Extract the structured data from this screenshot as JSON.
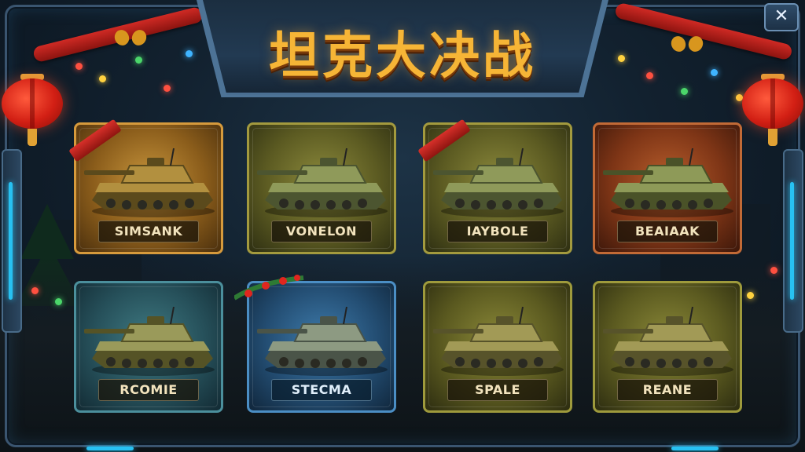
{
  "title": "坦克大决战",
  "close_button": {
    "icon": "close-x-icon",
    "glyph": "✕"
  },
  "colors": {
    "title_gold": "#f6b536",
    "frame_blue": "#4d7396",
    "accent_cyan": "#27c1f2"
  },
  "tanks": [
    {
      "name": "SIMSANK",
      "frame_color": "gold",
      "festive": "ribbon"
    },
    {
      "name": "VONELON",
      "frame_color": "olive",
      "festive": "none"
    },
    {
      "name": "IAYBOLE",
      "frame_color": "olive",
      "festive": "ribbon"
    },
    {
      "name": "BEAIAAK",
      "frame_color": "rust",
      "festive": "none"
    },
    {
      "name": "RCOMIE",
      "frame_color": "teal",
      "festive": "none"
    },
    {
      "name": "STECMA",
      "frame_color": "blue",
      "festive": "holly"
    },
    {
      "name": "SPALE",
      "frame_color": "khaki",
      "festive": "none"
    },
    {
      "name": "REANE",
      "frame_color": "khaki",
      "festive": "none"
    }
  ],
  "decorations": {
    "lanterns": [
      "lantern-left",
      "lantern-right"
    ],
    "garlands": [
      "garland-left",
      "garland-right"
    ]
  }
}
